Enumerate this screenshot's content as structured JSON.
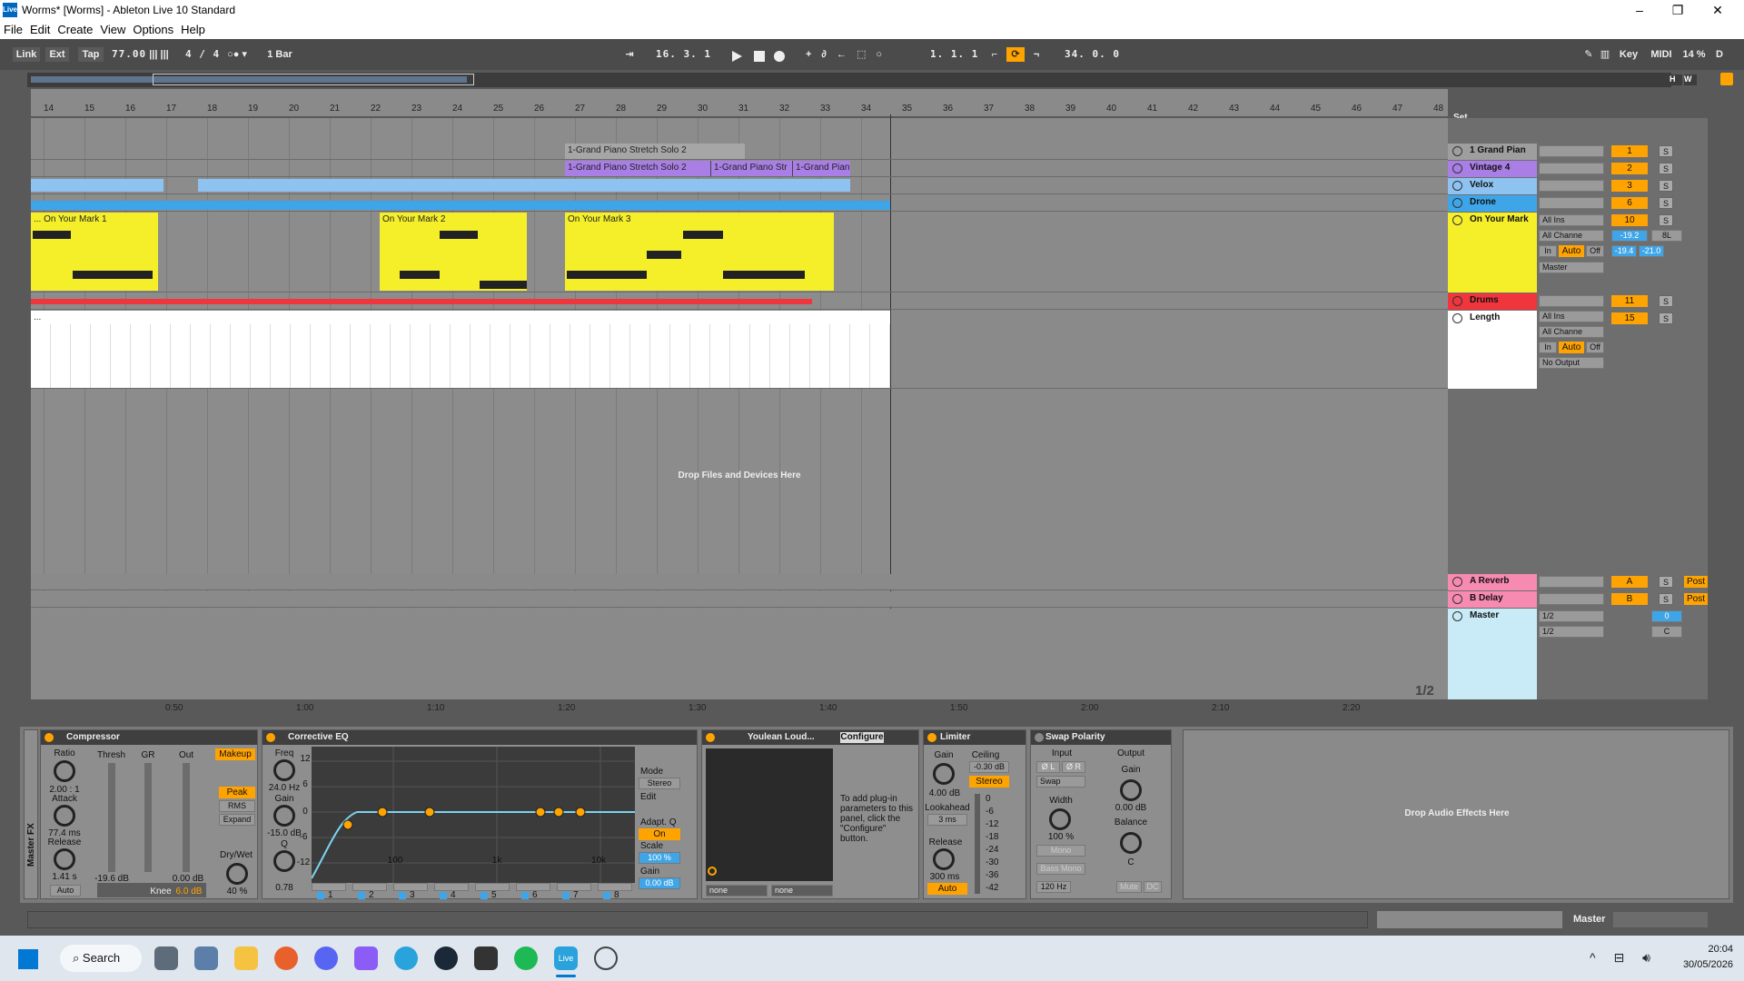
{
  "window": {
    "title": "Worms* [Worms] - Ableton Live 10 Standard",
    "logo": "Live"
  },
  "menu": [
    "File",
    "Edit",
    "Create",
    "View",
    "Options",
    "Help"
  ],
  "transport": {
    "link": "Link",
    "ext": "Ext",
    "tap": "Tap",
    "tempo": "77.00",
    "signature": "4 / 4",
    "quantize": "1 Bar",
    "position": "16.  3.  1",
    "loop_start": "1.  1.  1",
    "loop_length": "34.  0.  0",
    "key": "Key",
    "midi": "MIDI",
    "cpu": "14 %",
    "d": "D"
  },
  "overview": {
    "h": "H",
    "w": "W"
  },
  "ruler": {
    "bars": [
      "14",
      "15",
      "16",
      "17",
      "18",
      "19",
      "20",
      "21",
      "22",
      "23",
      "24",
      "25",
      "26",
      "27",
      "28",
      "29",
      "30",
      "31",
      "32",
      "33",
      "34",
      "35",
      "36",
      "37",
      "38",
      "39",
      "40",
      "41",
      "42",
      "43",
      "44",
      "45",
      "46",
      "47",
      "48"
    ],
    "times": [
      "0:50",
      "1:00",
      "1:10",
      "1:20",
      "1:30",
      "1:40",
      "1:50",
      "2:00",
      "2:10",
      "2:20"
    ],
    "set": "Set"
  },
  "clips": {
    "grand_piano": "1-Grand Piano Stretch Solo 2",
    "vintage_a": "1-Grand Piano Stretch Solo 2",
    "vintage_b": "1-Grand Piano Str",
    "vintage_c": "1-Grand Pian",
    "mark1": "... On Your Mark 1",
    "mark2": "On Your Mark 2",
    "mark3": "On Your Mark 3",
    "length_clip": "...",
    "drop": "Drop Files and Devices Here",
    "page": "1/2"
  },
  "tracks": [
    {
      "name": "1 Grand Pian",
      "num": "1",
      "color": "#9e9e9e"
    },
    {
      "name": "Vintage 4",
      "num": "2",
      "color": "#a97fe6"
    },
    {
      "name": "Velox",
      "num": "3",
      "color": "#8ec2f0"
    },
    {
      "name": "Drone",
      "num": "6",
      "color": "#3ea6e8"
    },
    {
      "name": "On Your Mark",
      "num": "10",
      "color": "#f5ef2a"
    },
    {
      "name": "Drums",
      "num": "11",
      "color": "#f0353c"
    },
    {
      "name": "Length",
      "num": "15",
      "color": "#ffffff"
    },
    {
      "name": "A Reverb",
      "num": "A",
      "color": "#f78ab0"
    },
    {
      "name": "B Delay",
      "num": "B",
      "color": "#f78ab0"
    },
    {
      "name": "Master",
      "num": "0",
      "color": "#c8ebf7"
    }
  ],
  "io": {
    "all_ins": "All Ins",
    "all_channels": "All Channe",
    "in": "In",
    "auto": "Auto",
    "off": "Off",
    "master": "Master",
    "no_output": "No Output",
    "vol1": "-19.2",
    "pan1": "8L",
    "peak1": "-19.4",
    "peak2": "-21.0",
    "post": "Post",
    "half": "1/2",
    "c": "C",
    "s": "S"
  },
  "devices": {
    "chain_label": "Master FX",
    "compressor": {
      "title": "Compressor",
      "ratio_l": "Ratio",
      "ratio": "2.00 : 1",
      "attack_l": "Attack",
      "attack": "77.4 ms",
      "release_l": "Release",
      "release": "1.41 s",
      "auto": "Auto",
      "thresh": "Thresh",
      "gr": "GR",
      "out": "Out",
      "thresh_v": "-19.6 dB",
      "out_v": "0.00 dB",
      "makeup": "Makeup",
      "peak": "Peak",
      "rms": "RMS",
      "expand": "Expand",
      "drywet_l": "Dry/Wet",
      "drywet": "40 %",
      "knee": "Knee",
      "knee_v": "6.0 dB"
    },
    "eq": {
      "title": "Corrective EQ",
      "freq_l": "Freq",
      "freq": "24.0 Hz",
      "gain_l": "Gain",
      "gain": "-15.0 dB",
      "q_l": "Q",
      "q": "0.78",
      "db12": "12",
      "db6": "6",
      "db0": "0",
      "dbm6": "-6",
      "dbm12": "-12",
      "f100": "100",
      "f1k": "1k",
      "f10k": "10k",
      "mode_l": "Mode",
      "mode": "Stereo",
      "edit": "Edit",
      "adaptq": "Adapt. Q",
      "on": "On",
      "scale_l": "Scale",
      "scale": "100 %",
      "gain2_l": "Gain",
      "gain2": "0.00 dB",
      "bands": [
        "1",
        "2",
        "3",
        "4",
        "5",
        "6",
        "7",
        "8"
      ]
    },
    "youlean": {
      "title": "Youlean Loud...",
      "configure": "Configure",
      "msg": "To add plug-in parameters to this panel, click the \"Configure\" button.",
      "none1": "none",
      "none2": "none"
    },
    "limiter": {
      "title": "Limiter",
      "gain_l": "Gain",
      "gain": "4.00 dB",
      "ceiling_l": "Ceiling",
      "ceiling": "-0.30 dB",
      "stereo": "Stereo",
      "lookahead_l": "Lookahead",
      "lookahead": "3 ms",
      "release_l": "Release",
      "release": "300 ms",
      "auto": "Auto",
      "scale": [
        "0",
        "-6",
        "-12",
        "-18",
        "-24",
        "-30",
        "-36",
        "-42"
      ]
    },
    "swap": {
      "title": "Swap Polarity",
      "input_l": "Input",
      "output_l": "Output",
      "phl": "Ø L",
      "phr": "Ø R",
      "swap": "Swap",
      "width_l": "Width",
      "width": "100 %",
      "mono": "Mono",
      "bass_mono": "Bass Mono",
      "hz": "120 Hz",
      "gain_l": "Gain",
      "gain": "0.00 dB",
      "balance_l": "Balance",
      "balance": "C",
      "mute": "Mute",
      "dc": "DC"
    },
    "drop": "Drop Audio Effects Here"
  },
  "status": {
    "master": "Master"
  },
  "taskbar": {
    "search": "Search",
    "time": "20:04",
    "date": "30/05/2026",
    "live_icon": "Live"
  }
}
